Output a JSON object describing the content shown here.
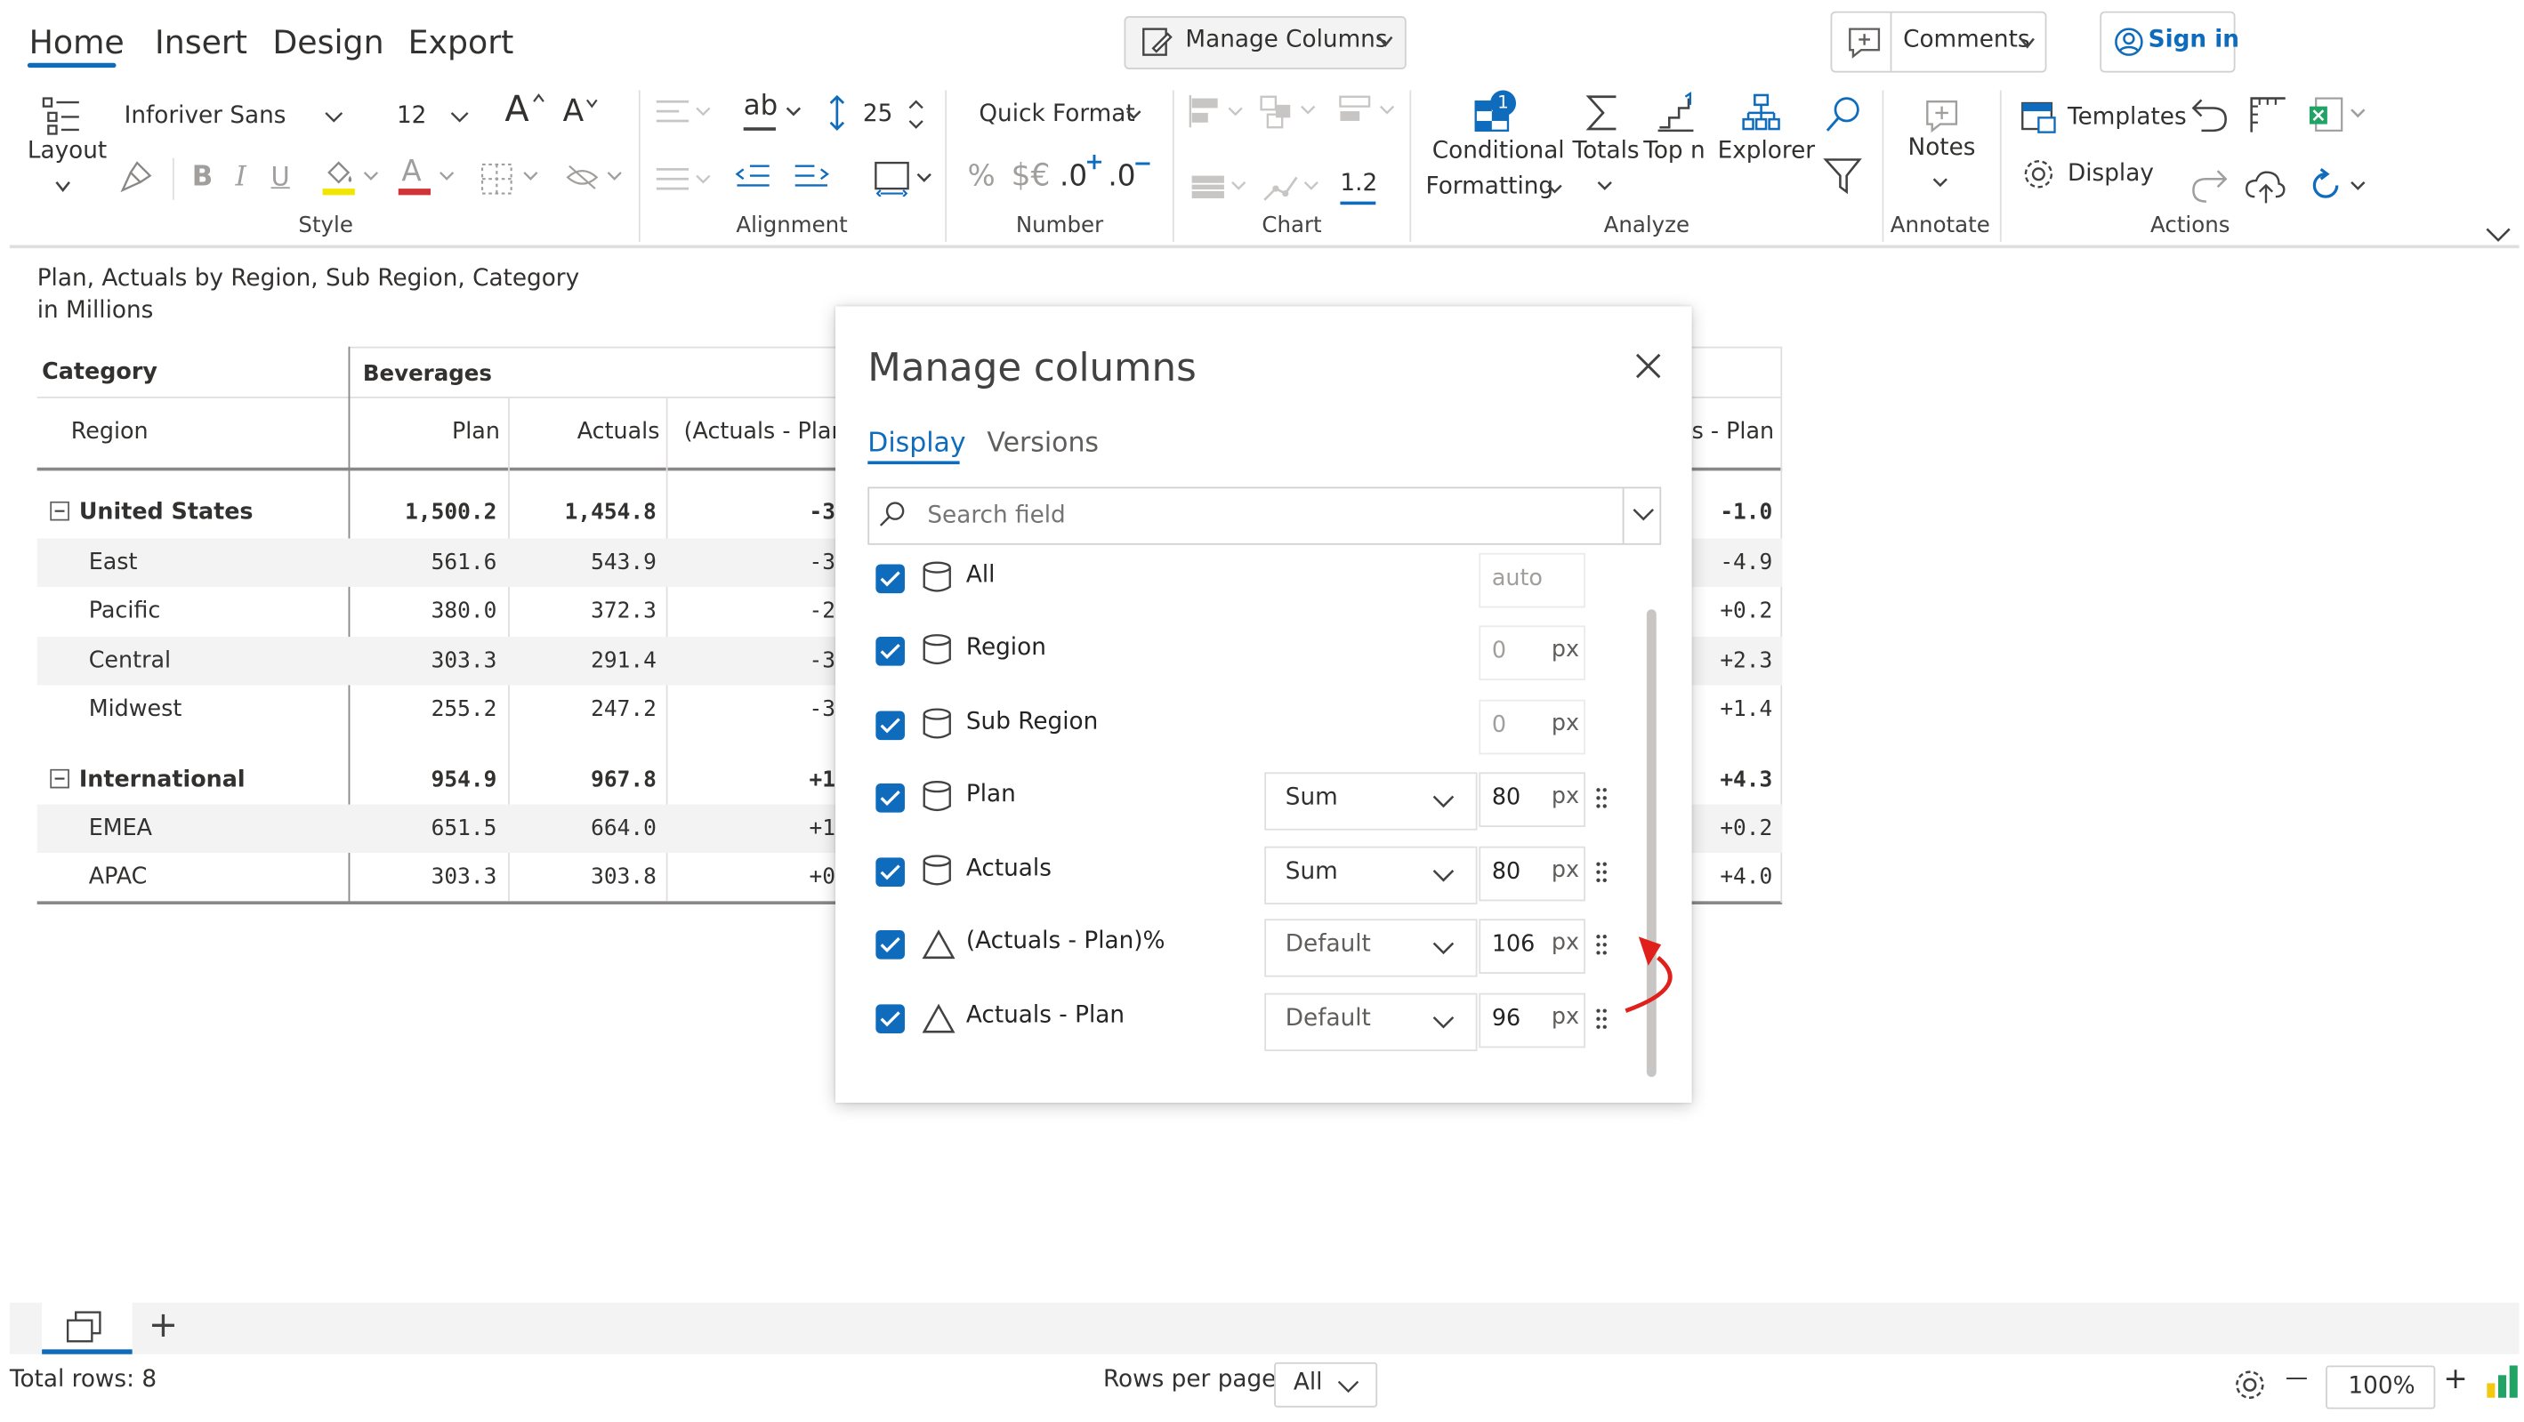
{
  "ribbon": {
    "tabs": [
      "Home",
      "Insert",
      "Design",
      "Export"
    ],
    "manage_columns": "Manage Columns",
    "comments": "Comments",
    "sign_in": "Sign in",
    "layout_label": "Layout",
    "font_family": "Inforiver Sans",
    "font_size": "12",
    "line_height": "25",
    "quick_format": "Quick Format",
    "percent": "%",
    "currency": "$€",
    "inc_decimal": ".0",
    "dec_decimal": ".0",
    "chart_value": "1.2",
    "conditional_1": "Conditional",
    "conditional_2": "Formatting",
    "conditional_badge": "1",
    "totals": "Totals",
    "top_n": "Top n",
    "explorer": "Explorer",
    "notes": "Notes",
    "templates": "Templates",
    "display": "Display",
    "groups": {
      "style": "Style",
      "alignment": "Alignment",
      "number": "Number",
      "chart": "Chart",
      "analyze": "Analyze",
      "annotate": "Annotate",
      "actions": "Actions"
    },
    "style_glyphs": {
      "bold": "B",
      "italic": "I",
      "underline": "U",
      "font_color": "A",
      "grow": "A",
      "shrink": "A",
      "ab": "ab"
    }
  },
  "report": {
    "title": "Plan, Actuals by Region, Sub Region, Category",
    "subtitle": "in Millions",
    "header": {
      "category_label": "Category",
      "category_value": "Beverages",
      "region_label": "Region",
      "columns": [
        "Plan",
        "Actuals",
        "(Actuals - Plan",
        "s - Plan"
      ]
    },
    "rows": [
      {
        "label": "United States",
        "group": true,
        "plan": "1,500.2",
        "actuals": "1,454.8",
        "variance": "-3",
        "diff": "-1.0"
      },
      {
        "label": "East",
        "group": false,
        "plan": "561.6",
        "actuals": "543.9",
        "variance": "-3",
        "diff": "-4.9"
      },
      {
        "label": "Pacific",
        "group": false,
        "plan": "380.0",
        "actuals": "372.3",
        "variance": "-2",
        "diff": "+0.2"
      },
      {
        "label": "Central",
        "group": false,
        "plan": "303.3",
        "actuals": "291.4",
        "variance": "-3",
        "diff": "+2.3"
      },
      {
        "label": "Midwest",
        "group": false,
        "plan": "255.2",
        "actuals": "247.2",
        "variance": "-3",
        "diff": "+1.4"
      },
      {
        "label": "International",
        "group": true,
        "plan": "954.9",
        "actuals": "967.8",
        "variance": "+1",
        "diff": "+4.3"
      },
      {
        "label": "EMEA",
        "group": false,
        "plan": "651.5",
        "actuals": "664.0",
        "variance": "+1",
        "diff": "+0.2"
      },
      {
        "label": "APAC",
        "group": false,
        "plan": "303.3",
        "actuals": "303.8",
        "variance": "+0",
        "diff": "+4.0"
      }
    ]
  },
  "dialog": {
    "title": "Manage columns",
    "tabs": [
      "Display",
      "Versions"
    ],
    "active_tab": "Display",
    "search_placeholder": "Search field",
    "px_unit": "px",
    "fields": [
      {
        "label": "All",
        "icon": "cylinder-icon",
        "checked": true,
        "aggregation": "",
        "width": "auto"
      },
      {
        "label": "Region",
        "icon": "cylinder-icon",
        "checked": true,
        "aggregation": "",
        "width": "0"
      },
      {
        "label": "Sub Region",
        "icon": "cylinder-icon",
        "checked": true,
        "aggregation": "",
        "width": "0"
      },
      {
        "label": "Plan",
        "icon": "cylinder-icon",
        "checked": true,
        "aggregation": "Sum",
        "width": "80"
      },
      {
        "label": "Actuals",
        "icon": "cylinder-icon",
        "checked": true,
        "aggregation": "Sum",
        "width": "80"
      },
      {
        "label": "(Actuals - Plan)%",
        "icon": "triangle-icon",
        "checked": true,
        "aggregation": "Default",
        "width": "106"
      },
      {
        "label": "Actuals - Plan",
        "icon": "triangle-icon",
        "checked": true,
        "aggregation": "Default",
        "width": "96"
      }
    ]
  },
  "footer": {
    "total_rows": "Total rows: 8",
    "rows_per_page_label": "Rows per page:",
    "rows_per_page_value": "All",
    "zoom": "100%",
    "add_sheet": "+",
    "zoom_minus": "—",
    "zoom_plus": "+"
  },
  "colors": {
    "accent": "#0f6cbd",
    "arrow": "#e0201b",
    "highlight_yellow": "#f2e500",
    "font_red": "#d13438",
    "excel_green": "#21a366"
  }
}
